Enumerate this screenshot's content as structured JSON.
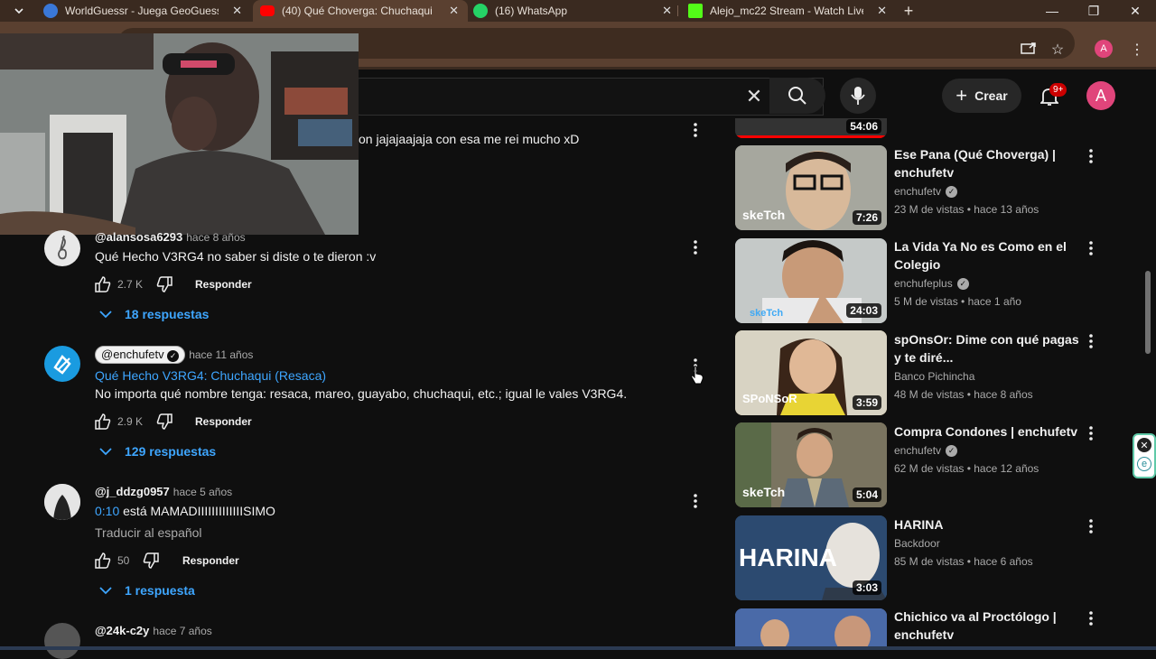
{
  "browser": {
    "tabs": [
      {
        "title": "WorldGuessr - Juega GeoGuessr",
        "fav_color": "#3a78d8"
      },
      {
        "title": "(40) Qué Choverga: Chuchaqui",
        "fav_color": "#ff0000"
      },
      {
        "title": "(16) WhatsApp",
        "fav_color": "#25d366"
      },
      {
        "title": "Alejo_mc22 Stream - Watch Live",
        "fav_color": "#53fc18"
      }
    ],
    "new_tab": "+",
    "profile_letter": "A"
  },
  "youtube": {
    "create_label": "Crear",
    "notif_badge": "9+",
    "avatar_letter": "A",
    "clear_symbol": "✕"
  },
  "comments": [
    {
      "partial_text": "on jajajaajaja con esa me rei mucho xD"
    },
    {
      "author": "@alansosa6293",
      "time": "hace 8 años",
      "text": "Qué Hecho V3RG4 no saber si diste o te dieron :v",
      "likes": "2.7 K",
      "reply_label": "Responder",
      "replies": "18 respuestas"
    },
    {
      "author": "@enchufetv",
      "time": "hace 11 años",
      "link": "Qué Hecho V3RG4: Chuchaqui (Resaca)",
      "text": "No importa qué nombre tenga: resaca, mareo, guayabo, chuchaqui, etc.; igual le vales V3RG4.",
      "likes": "2.9 K",
      "reply_label": "Responder",
      "replies": "129 respuestas"
    },
    {
      "author": "@j_ddzg0957",
      "time": "hace 5 años",
      "timestamp": "0:10",
      "text": " está MAMADIIIIIIIIIIIIISIMO",
      "translate": "Traducir al español",
      "likes": "50",
      "reply_label": "Responder",
      "replies": "1 respuesta"
    },
    {
      "author": "@24k-c2y",
      "time": "hace 7 años"
    }
  ],
  "sidebar": {
    "top_partial_duration": "54:06",
    "videos": [
      {
        "title": "Ese Pana (Qué Choverga) | enchufetv",
        "channel": "enchufetv",
        "verified": true,
        "views": "23 M de vistas",
        "age": "hace 13 años",
        "duration": "7:26",
        "bg": "#8a8f86"
      },
      {
        "title": "La Vida Ya No es Como en el Colegio",
        "channel": "enchufeplus",
        "verified": true,
        "views": "5 M de vistas",
        "age": "hace 1 año",
        "duration": "24:03",
        "bg": "#7b8ea0"
      },
      {
        "title": "spOnsOr: Dime con qué pagas y te diré...",
        "channel": "Banco Pichincha",
        "verified": false,
        "views": "48 M de vistas",
        "age": "hace 8 años",
        "duration": "3:59",
        "bg": "#c9b26a"
      },
      {
        "title": "Compra Condones | enchufetv",
        "channel": "enchufetv",
        "verified": true,
        "views": "62 M de vistas",
        "age": "hace 12 años",
        "duration": "5:04",
        "bg": "#8e7a5a"
      },
      {
        "title": "HARINA",
        "channel": "Backdoor",
        "verified": false,
        "views": "85 M de vistas",
        "age": "hace 6 años",
        "duration": "3:03",
        "bg": "#3b5f8a"
      },
      {
        "title": "Chichico va al Proctólogo | enchufetv",
        "channel": "",
        "verified": false,
        "views": "",
        "age": "",
        "duration": "",
        "bg": "#5a7ab8"
      }
    ],
    "thumb_labels": [
      "skeTch",
      "skeTch",
      "SPoNSoR",
      "skeTch",
      "HARINA"
    ]
  },
  "colors": {
    "accent_link": "#3ea6ff",
    "brand_red": "#ff0000",
    "profile_pink": "#e0457b"
  }
}
